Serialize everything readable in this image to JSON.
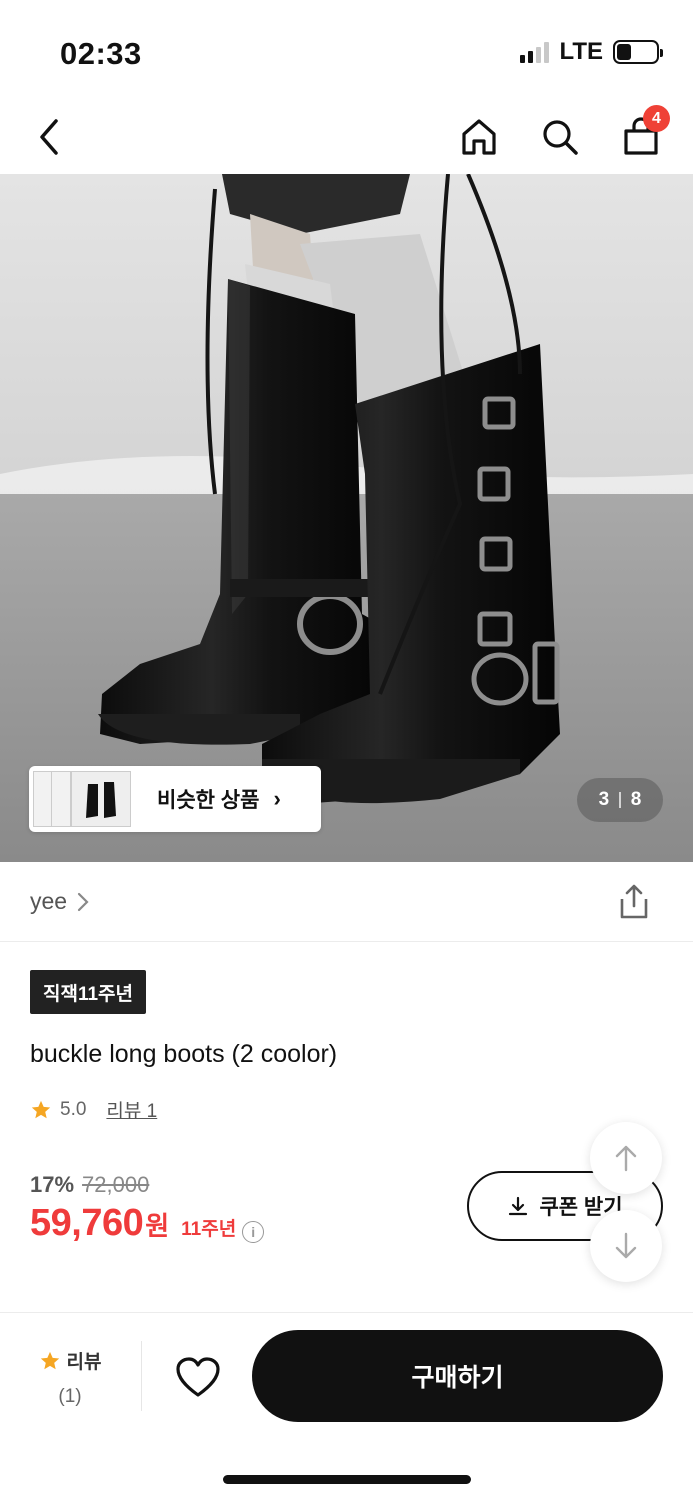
{
  "status": {
    "time": "02:33",
    "network": "LTE"
  },
  "nav": {
    "cart_count": "4"
  },
  "hero": {
    "similar_label": "비슷한 상품",
    "page_current": "3",
    "page_total": "8"
  },
  "brand": {
    "name": "yee"
  },
  "product": {
    "tag": "직잭11주년",
    "title": "buckle long boots (2 coolor)",
    "rating": "5.0",
    "review_link": "리뷰 1",
    "discount_rate": "17%",
    "original_price": "72,000",
    "final_price": "59,760",
    "currency": "원",
    "anniversary_label": "11주년",
    "coupon_label": "쿠폰 받기"
  },
  "bottom": {
    "review_label": "리뷰",
    "review_count": "(1)",
    "buy_label": "구매하기"
  },
  "colors": {
    "sale": "#ef3b3b",
    "badge": "#ef4136",
    "primary": "#111111",
    "star": "#f5a623"
  }
}
